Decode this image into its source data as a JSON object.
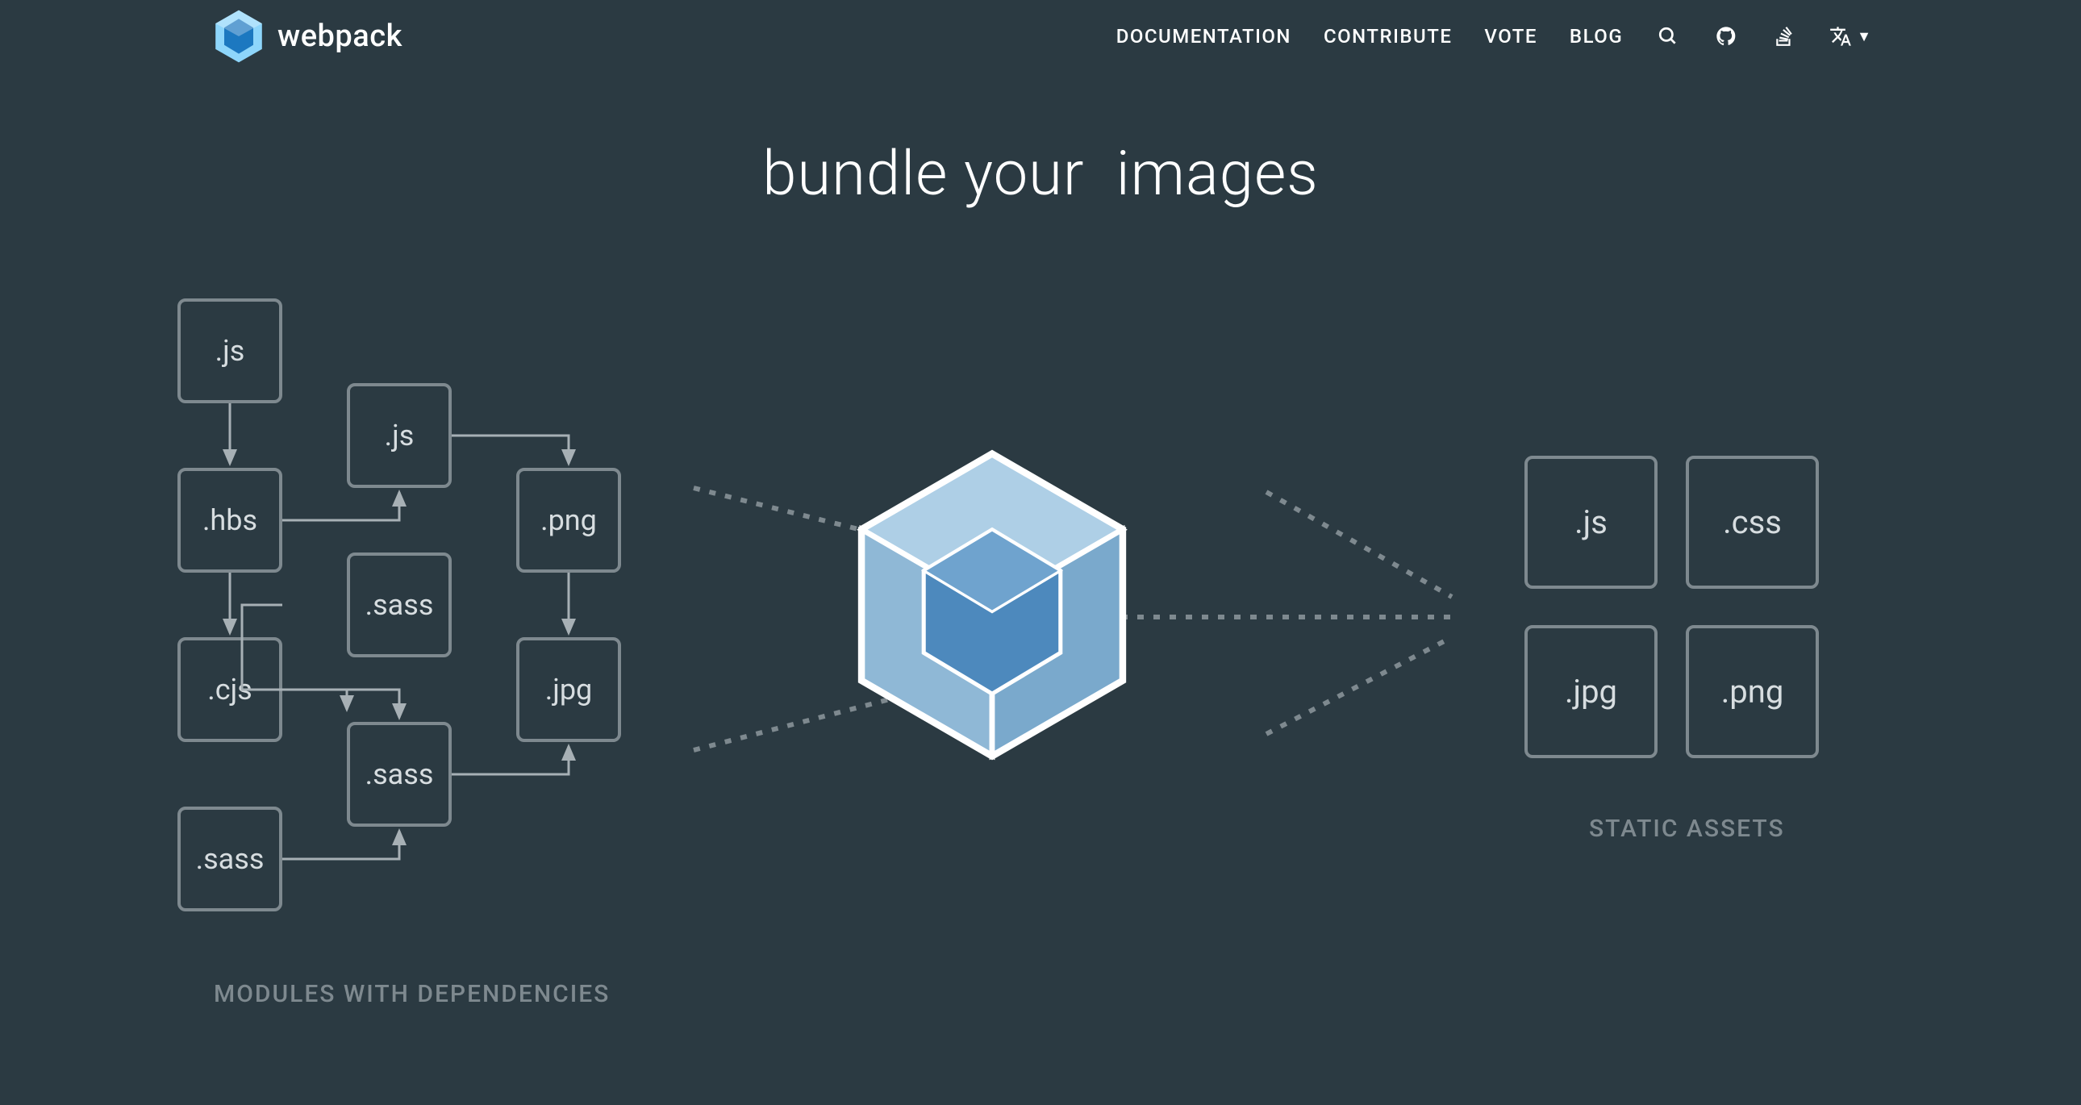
{
  "brand": "webpack",
  "nav": {
    "documentation": "DOCUMENTATION",
    "contribute": "CONTRIBUTE",
    "vote": "VOTE",
    "blog": "BLOG"
  },
  "hero": {
    "prefix": "bundle your",
    "suffix": "images"
  },
  "modules_label": "MODULES WITH DEPENDENCIES",
  "assets_label": "STATIC ASSETS",
  "modules": {
    "m0": ".js",
    "m1": ".js",
    "m2": ".hbs",
    "m3": ".png",
    "m4": ".sass",
    "m5": ".cjs",
    "m6": ".jpg",
    "m7": ".sass",
    "m8": ".sass"
  },
  "outputs": {
    "o0": ".js",
    "o1": ".css",
    "o2": ".jpg",
    "o3": ".png"
  }
}
